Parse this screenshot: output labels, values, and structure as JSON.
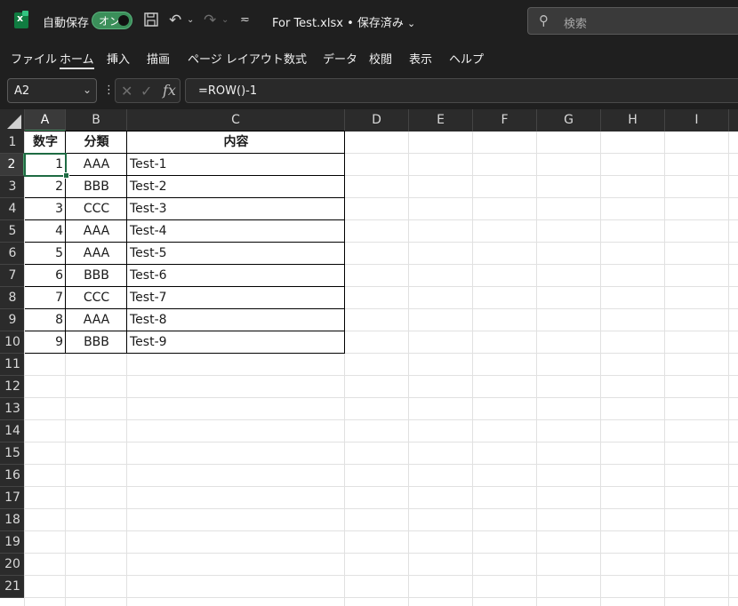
{
  "titlebar": {
    "autosave_label": "自動保存",
    "toggle_label": "オン",
    "doc_title": "For Test.xlsx • 保存済み",
    "search_placeholder": "検索"
  },
  "ribbon": {
    "tabs": [
      {
        "label": "ファイル"
      },
      {
        "label": "ホーム",
        "active": true
      },
      {
        "label": "挿入"
      },
      {
        "label": "描画"
      },
      {
        "label": "ページ レイアウト"
      },
      {
        "label": "数式"
      },
      {
        "label": "データ"
      },
      {
        "label": "校閲"
      },
      {
        "label": "表示"
      },
      {
        "label": "ヘルプ"
      }
    ]
  },
  "formula_bar": {
    "name_box": "A2",
    "formula": "=ROW()-1"
  },
  "columns": [
    "A",
    "B",
    "C",
    "D",
    "E",
    "F",
    "G",
    "H",
    "I"
  ],
  "rows": [
    "1",
    "2",
    "3",
    "4",
    "5",
    "6",
    "7",
    "8",
    "9",
    "10",
    "11",
    "12",
    "13",
    "14",
    "15",
    "16",
    "17",
    "18",
    "19",
    "20",
    "21"
  ],
  "table": {
    "headers": [
      "数字",
      "分類",
      "内容"
    ],
    "rows": [
      [
        "1",
        "AAA",
        "Test-1"
      ],
      [
        "2",
        "BBB",
        "Test-2"
      ],
      [
        "3",
        "CCC",
        "Test-3"
      ],
      [
        "4",
        "AAA",
        "Test-4"
      ],
      [
        "5",
        "AAA",
        "Test-5"
      ],
      [
        "6",
        "BBB",
        "Test-6"
      ],
      [
        "7",
        "CCC",
        "Test-7"
      ],
      [
        "8",
        "AAA",
        "Test-8"
      ],
      [
        "9",
        "BBB",
        "Test-9"
      ]
    ]
  },
  "colors": {
    "accent": "#107c41",
    "selection": "#1e6b43"
  }
}
